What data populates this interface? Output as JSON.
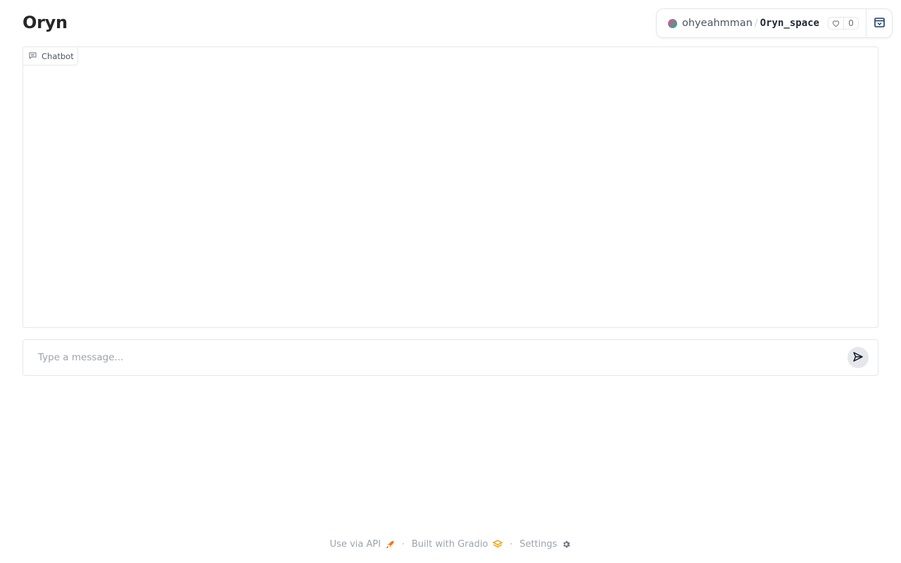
{
  "app": {
    "title": "Oryn"
  },
  "space_badge": {
    "owner": "ohyeahmman",
    "separator": "/",
    "space_name": "Oryn_space",
    "likes": "0"
  },
  "chatbot": {
    "label": "Chatbot"
  },
  "input": {
    "placeholder": "Type a message..."
  },
  "footer": {
    "api_label": "Use via API",
    "built_label": "Built with Gradio",
    "settings_label": "Settings",
    "separator": "·"
  },
  "icons": {
    "chatbot": "chat-bubble-icon",
    "send": "send-arrow-icon",
    "like": "heart-icon",
    "collapse": "collapse-icon",
    "api": "rocket-icon",
    "gradio": "gradio-logo-icon",
    "settings": "gear-icon"
  },
  "colors": {
    "gradio_orange": "#f59e0b",
    "rocket": "#f97316"
  }
}
